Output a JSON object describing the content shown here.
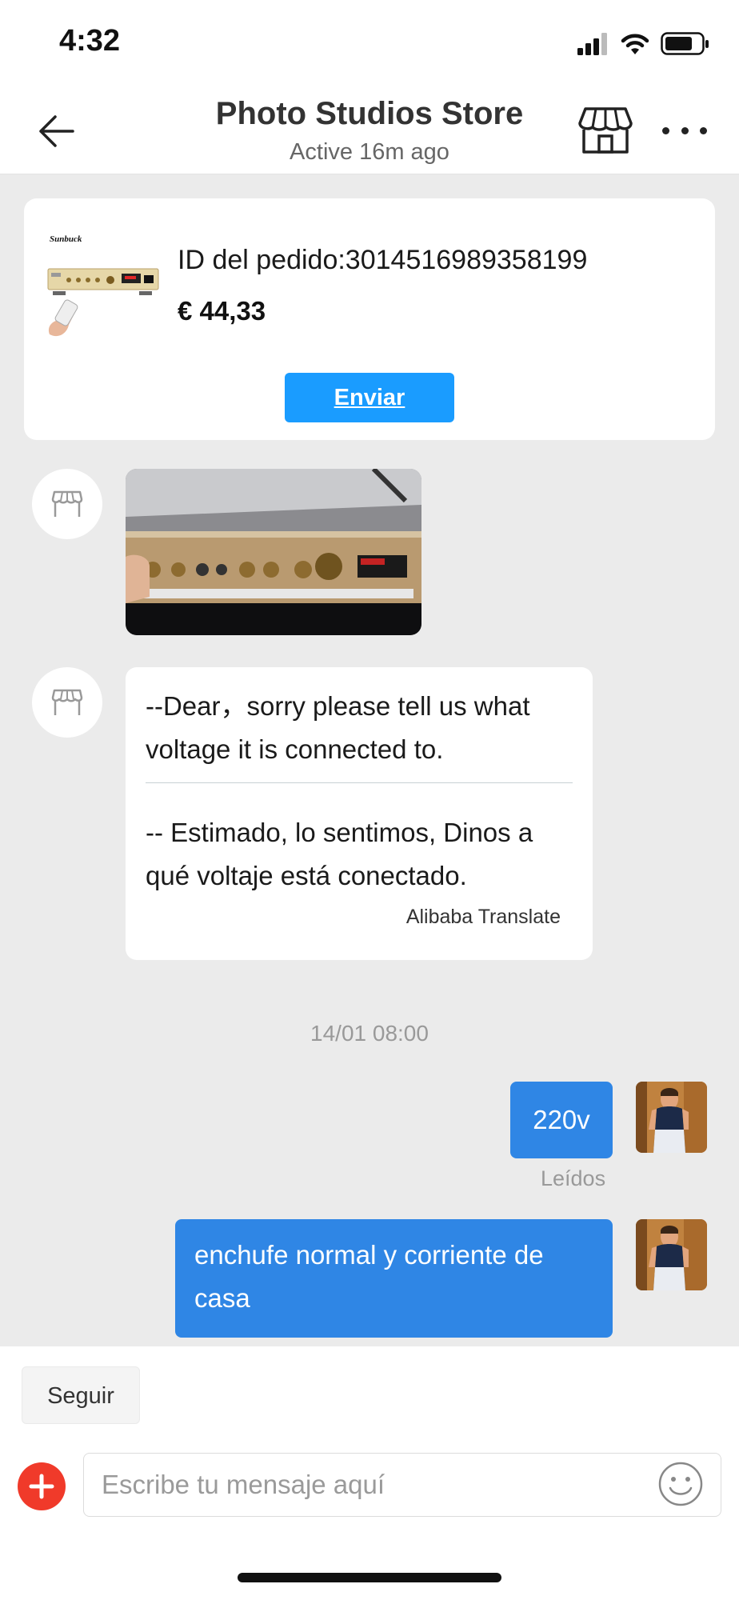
{
  "status_bar": {
    "time": "4:32",
    "icons": [
      "signal-icon",
      "wifi-icon",
      "battery-icon"
    ]
  },
  "header": {
    "title": "Photo Studios Store",
    "subtitle": "Active 16m ago",
    "icons": [
      "back-arrow-icon",
      "store-icon",
      "more-icon"
    ]
  },
  "order_card": {
    "order_id": "ID del pedido:3014516989358199",
    "price": "€ 44,33",
    "send_label": "Enviar",
    "thumb_brand": "Sunbuck"
  },
  "messages": {
    "seller_text_en": "--Dear，sorry please tell us what voltage it is connected to.",
    "seller_text_es": "-- Estimado, lo sentimos, Dinos a qué voltaje está conectado.",
    "translate_label": "Alibaba Translate",
    "timestamp": "14/01 08:00",
    "my_message_1": "220v",
    "read_status": "Leídos",
    "my_message_2": "enchufe normal y corriente de casa"
  },
  "bottom": {
    "follow_label": "Seguir",
    "input_placeholder": "Escribe tu mensaje aquí",
    "input_value": ""
  },
  "colors": {
    "chat_background": "#ebebeb",
    "my_bubble": "#2f86e5",
    "send_button": "#1a9cff",
    "add_button": "#f03a2a"
  }
}
